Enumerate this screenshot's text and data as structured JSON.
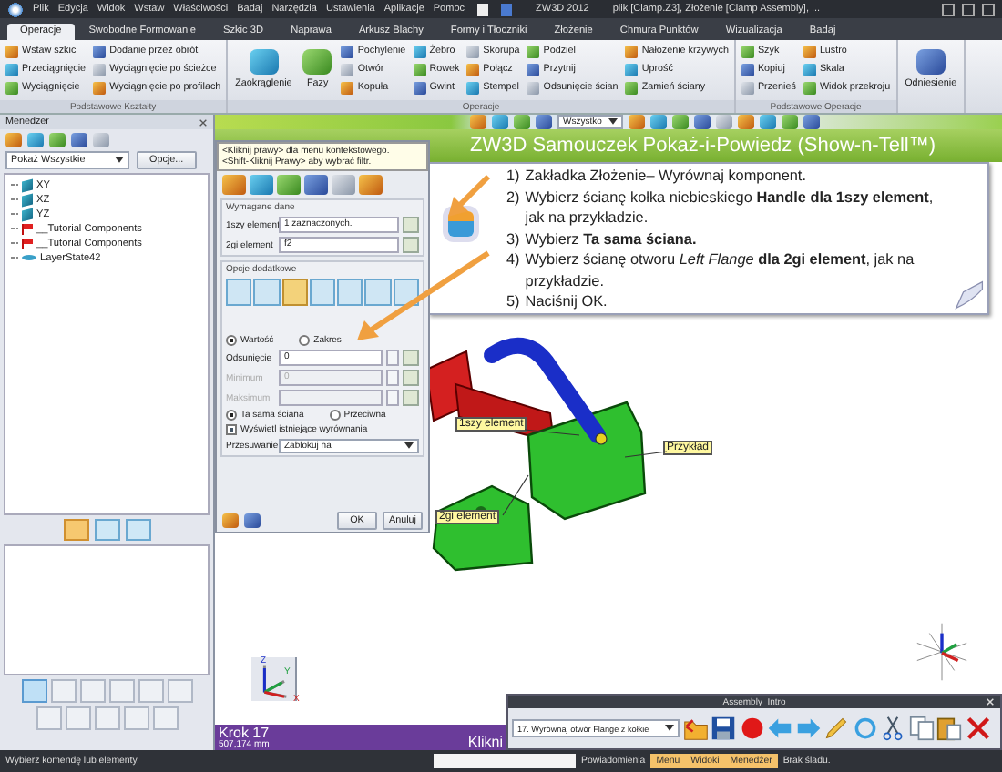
{
  "menu_bar": {
    "items": [
      "Plik",
      "Edycja",
      "Widok",
      "Wstaw",
      "Właściwości",
      "Badaj",
      "Narzędzia",
      "Ustawienia",
      "Aplikacje",
      "Pomoc"
    ],
    "app_title": "ZW3D 2012",
    "document_title": "plik [Clamp.Z3], Złożenie [Clamp Assembly], ..."
  },
  "ribbon_tabs": [
    {
      "label": "Operacje",
      "selected": true
    },
    {
      "label": "Swobodne Formowanie",
      "selected": false
    },
    {
      "label": "Szkic 3D",
      "selected": false
    },
    {
      "label": "Naprawa",
      "selected": false
    },
    {
      "label": "Arkusz Blachy",
      "selected": false
    },
    {
      "label": "Formy i Tłoczniki",
      "selected": false
    },
    {
      "label": "Złożenie",
      "selected": false
    },
    {
      "label": "Chmura Punktów",
      "selected": false
    },
    {
      "label": "Wizualizacja",
      "selected": false
    },
    {
      "label": "Badaj",
      "selected": false
    }
  ],
  "ribbon_groups": [
    {
      "label": "Podstawowe Kształty",
      "tools": [
        {
          "label": "Wstaw szkic",
          "kind": "small"
        },
        {
          "label": "Przeciągnięcie",
          "kind": "small"
        },
        {
          "label": "Wyciągnięcie",
          "kind": "small"
        },
        {
          "label": "Dodanie przez obrót",
          "kind": "small"
        },
        {
          "label": "Wyciągnięcie po ścieżce",
          "kind": "small"
        },
        {
          "label": "Wyciągnięcie po profilach",
          "kind": "small"
        }
      ]
    },
    {
      "label": "Operacje",
      "tools": [
        {
          "label": "Zaokrąglenie",
          "kind": "large"
        },
        {
          "label": "Fazy",
          "kind": "large"
        },
        {
          "label": "Pochylenie",
          "kind": "small"
        },
        {
          "label": "Otwór",
          "kind": "small"
        },
        {
          "label": "Kopuła",
          "kind": "small"
        },
        {
          "label": "Żebro",
          "kind": "small"
        },
        {
          "label": "Rowek",
          "kind": "small"
        },
        {
          "label": "Gwint",
          "kind": "small"
        },
        {
          "label": "Skorupa",
          "kind": "small"
        },
        {
          "label": "Połącz",
          "kind": "small"
        },
        {
          "label": "Stempel",
          "kind": "small"
        },
        {
          "label": "Podziel",
          "kind": "small"
        },
        {
          "label": "Przytnij",
          "kind": "small"
        },
        {
          "label": "Odsunięcie ścian",
          "kind": "small"
        },
        {
          "label": "Nałożenie krzywych",
          "kind": "small"
        },
        {
          "label": "Uprość",
          "kind": "small"
        },
        {
          "label": "Zamień ściany",
          "kind": "small"
        }
      ]
    },
    {
      "label": "Podstawowe Operacje",
      "tools": [
        {
          "label": "Szyk",
          "kind": "small"
        },
        {
          "label": "Kopiuj",
          "kind": "small"
        },
        {
          "label": "Przenieś",
          "kind": "small"
        },
        {
          "label": "Lustro",
          "kind": "small"
        },
        {
          "label": "Skala",
          "kind": "small"
        },
        {
          "label": "Widok przekroju",
          "kind": "small"
        }
      ]
    },
    {
      "tools": [
        {
          "label": "Odniesienie",
          "kind": "large"
        }
      ]
    }
  ],
  "manager_panel": {
    "title": "Menedżer",
    "filter": "Pokaż Wszystkie",
    "options_button": "Opcje...",
    "tree": [
      {
        "label": "XY",
        "kind": "plane"
      },
      {
        "label": "XZ",
        "kind": "plane"
      },
      {
        "label": "YZ",
        "kind": "plane"
      },
      {
        "label": "__Tutorial Components",
        "kind": "component"
      },
      {
        "label": "__Tutorial Components",
        "kind": "component"
      },
      {
        "label": "LayerState42",
        "kind": "layer"
      }
    ]
  },
  "canvas_toolbar": {
    "filter": "Wszystko"
  },
  "dialog": {
    "hint_lines": [
      "<Kliknij prawy> dla menu kontekstowego.",
      "<Shift-Kliknij Prawy> aby wybrać filtr."
    ],
    "required_title": "Wymagane dane",
    "fields": [
      {
        "label": "1szy element",
        "value": "1 zaznaczonych."
      },
      {
        "label": "2gi element",
        "value": "f2"
      }
    ],
    "options_title": "Opcje dodatkowe",
    "mode_options": [
      {
        "label": "Wartość",
        "selected": true
      },
      {
        "label": "Zakres",
        "selected": false
      }
    ],
    "offset_fields": [
      {
        "label": "Odsunięcie",
        "value": "0",
        "disabled": false
      },
      {
        "label": "Minimum",
        "value": "0",
        "disabled": true
      },
      {
        "label": "Maksimum",
        "disabled": true
      }
    ],
    "face_options": [
      {
        "label": "Ta sama ściana",
        "selected": true
      },
      {
        "label": "Przeciwna",
        "selected": false
      }
    ],
    "show_existing": {
      "label": "Wyświetl istniejące wyrównania",
      "checked": true
    },
    "move": {
      "label": "Przesuwanie",
      "value": "Zablokuj na"
    },
    "buttons": [
      "OK",
      "Anuluj"
    ]
  },
  "tutorial": {
    "title": "ZW3D Samouczek Pokaż-i-Powiedz (Show-n-Tell™)",
    "steps": [
      {
        "number": "1)",
        "text": "Zakładka Złożenie– Wyrównaj komponent."
      },
      {
        "number": "2)",
        "text": "Wybierz ścianę kołka niebieskiego **Handle dla 1szy element**, jak na przykładzie."
      },
      {
        "number": "3)",
        "text": "Wybierz **Ta sama ściana.**"
      },
      {
        "number": "4)",
        "text": "Wybierz ścianę otworu *Left Flange* **dla 2gi element**, jak na przykładzie."
      },
      {
        "number": "5)",
        "text": "Naciśnij OK."
      }
    ],
    "callouts": [
      "1szy element",
      "Przykład",
      "2gi element"
    ],
    "step_label": "Krok 17",
    "measure": "507,174 mm",
    "hint": "Klikni",
    "axes": [
      "X",
      "Y",
      "Z"
    ]
  },
  "player": {
    "title": "Assembly_Intro",
    "step": "17. Wyrównaj otwór Flange z kołkie"
  },
  "status_bar": {
    "message": "Wybierz komendę lub elementy.",
    "tabs": [
      {
        "label": "Powiadomienia",
        "on": false
      },
      {
        "label": "Menu",
        "on": true
      },
      {
        "label": "Widoki",
        "on": true
      },
      {
        "label": "Menedżer",
        "on": true
      }
    ],
    "trace": "Brak śladu."
  }
}
